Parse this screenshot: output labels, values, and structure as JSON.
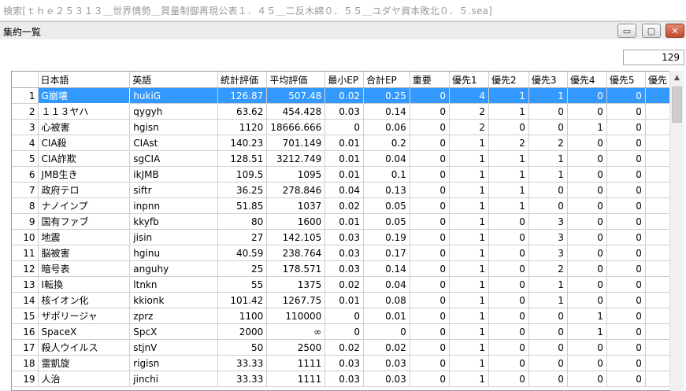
{
  "app_title": "検索[ｔｈｅ２５３１３＿世界情勢＿質量制御再現公表１．４５＿二反木綿０．５５＿ユダヤ資本敗北０．５.sea]",
  "window_title": "集約一覧",
  "window_controls": {
    "minimize": "▭",
    "maximize": "▢",
    "close": "✕"
  },
  "record_count": "129",
  "columns": [
    "日本語",
    "英語",
    "統計評価",
    "平均評価",
    "最小EP",
    "合計EP",
    "重要",
    "優先1",
    "優先2",
    "優先3",
    "優先4",
    "優先5",
    "優先"
  ],
  "rows": [
    {
      "n": "1",
      "ja": "G崩壊",
      "en": "hukiG",
      "v": [
        "126.87",
        "507.48",
        "0.02",
        "0.25",
        "0",
        "4",
        "1",
        "1",
        "0",
        "0",
        ""
      ]
    },
    {
      "n": "2",
      "ja": "１１３ヤハ",
      "en": "qygyh",
      "v": [
        "63.62",
        "454.428",
        "0.03",
        "0.14",
        "0",
        "2",
        "1",
        "0",
        "0",
        "0",
        ""
      ]
    },
    {
      "n": "3",
      "ja": "心被害",
      "en": "hgisn",
      "v": [
        "1120",
        "18666.666",
        "0",
        "0.06",
        "0",
        "2",
        "0",
        "0",
        "1",
        "0",
        ""
      ]
    },
    {
      "n": "4",
      "ja": "CIA殺",
      "en": "CIAst",
      "v": [
        "140.23",
        "701.149",
        "0.01",
        "0.2",
        "0",
        "1",
        "2",
        "2",
        "0",
        "0",
        ""
      ]
    },
    {
      "n": "5",
      "ja": "CIA詐欺",
      "en": "sgCIA",
      "v": [
        "128.51",
        "3212.749",
        "0.01",
        "0.04",
        "0",
        "1",
        "1",
        "1",
        "0",
        "0",
        ""
      ]
    },
    {
      "n": "6",
      "ja": "JMB生き",
      "en": "ikJMB",
      "v": [
        "109.5",
        "1095",
        "0.01",
        "0.1",
        "0",
        "1",
        "1",
        "1",
        "0",
        "0",
        ""
      ]
    },
    {
      "n": "7",
      "ja": "政府テロ",
      "en": "siftr",
      "v": [
        "36.25",
        "278.846",
        "0.04",
        "0.13",
        "0",
        "1",
        "1",
        "0",
        "0",
        "0",
        ""
      ]
    },
    {
      "n": "8",
      "ja": "ナノインプ",
      "en": "inpnn",
      "v": [
        "51.85",
        "1037",
        "0.02",
        "0.05",
        "0",
        "1",
        "1",
        "0",
        "0",
        "0",
        ""
      ]
    },
    {
      "n": "9",
      "ja": "国有ファブ",
      "en": "kkyfb",
      "v": [
        "80",
        "1600",
        "0.01",
        "0.05",
        "0",
        "1",
        "0",
        "3",
        "0",
        "0",
        ""
      ]
    },
    {
      "n": "10",
      "ja": "地震",
      "en": "jisin",
      "v": [
        "27",
        "142.105",
        "0.03",
        "0.19",
        "0",
        "1",
        "0",
        "3",
        "0",
        "0",
        ""
      ]
    },
    {
      "n": "11",
      "ja": "脳被害",
      "en": "hginu",
      "v": [
        "40.59",
        "238.764",
        "0.03",
        "0.17",
        "0",
        "1",
        "0",
        "3",
        "0",
        "0",
        ""
      ]
    },
    {
      "n": "12",
      "ja": "暗号表",
      "en": "anguhy",
      "v": [
        "25",
        "178.571",
        "0.03",
        "0.14",
        "0",
        "1",
        "0",
        "2",
        "0",
        "0",
        ""
      ]
    },
    {
      "n": "13",
      "ja": "I転換",
      "en": "ltnkn",
      "v": [
        "55",
        "1375",
        "0.02",
        "0.04",
        "0",
        "1",
        "0",
        "1",
        "0",
        "0",
        ""
      ]
    },
    {
      "n": "14",
      "ja": "核イオン化",
      "en": "kkionk",
      "v": [
        "101.42",
        "1267.75",
        "0.01",
        "0.08",
        "0",
        "1",
        "0",
        "1",
        "0",
        "0",
        ""
      ]
    },
    {
      "n": "15",
      "ja": "ザポリージャ",
      "en": "zprz",
      "v": [
        "1100",
        "110000",
        "0",
        "0.01",
        "0",
        "1",
        "0",
        "0",
        "1",
        "0",
        ""
      ]
    },
    {
      "n": "16",
      "ja": "SpaceX",
      "en": "SpcX",
      "v": [
        "2000",
        "∞",
        "0",
        "0",
        "0",
        "1",
        "0",
        "0",
        "1",
        "0",
        ""
      ]
    },
    {
      "n": "17",
      "ja": "殺人ウイルス",
      "en": "stjnV",
      "v": [
        "50",
        "2500",
        "0.02",
        "0.02",
        "0",
        "1",
        "0",
        "0",
        "0",
        "0",
        ""
      ]
    },
    {
      "n": "18",
      "ja": "霊凱旋",
      "en": "rigisn",
      "v": [
        "33.33",
        "1111",
        "0.03",
        "0.03",
        "0",
        "1",
        "0",
        "0",
        "0",
        "0",
        ""
      ]
    },
    {
      "n": "19",
      "ja": "人治",
      "en": "jinchi",
      "v": [
        "33.33",
        "1111",
        "0.03",
        "0.03",
        "0",
        "1",
        "0",
        "0",
        "0",
        "0",
        ""
      ]
    }
  ],
  "selected_row": "1"
}
